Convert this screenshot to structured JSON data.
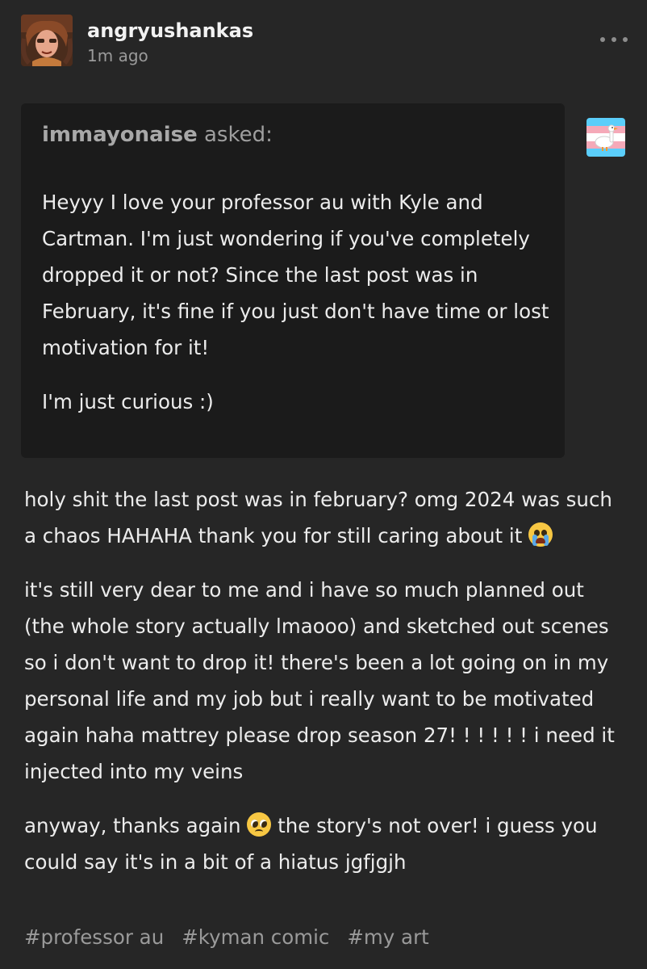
{
  "post": {
    "blog_name": "angryushankas",
    "timestamp": "1m ago",
    "more_icon": "more-horizontal-icon"
  },
  "ask": {
    "asker": "immayonaise",
    "asked_label": " asked:",
    "paragraphs": [
      "Heyyy I love your professor au with Kyle and Cartman. I'm just wondering if you've completely dropped it or not? Since the last post was in February, it's fine if you just don't have time or lost motivation for it!",
      "I'm just curious :)"
    ]
  },
  "answer": {
    "p1": "holy shit the last post was in february? omg 2024 was such a chaos HAHAHA thank you for still caring about it",
    "p2": "it's still very dear to me and i have so much planned out (the whole story actually lmaooo) and sketched out scenes so i don't want to drop it! there's been a lot going on in my personal life and my job but i really want to be motivated again haha mattrey please drop season 27! ! ! ! ! ! i need it injected into my veins",
    "p3_before": "anyway, thanks again",
    "p3_after": " the story's not over! i guess you could say it's in a bit of a hiatus jgfjgjh"
  },
  "tags": [
    "#professor au",
    "#kyman comic",
    "#my art"
  ],
  "colors": {
    "background": "#262626",
    "ask_box": "#1b1b1b",
    "text": "#ececec",
    "muted": "#9a9a9a",
    "trans_blue": "#5bcefa",
    "trans_pink": "#f5a9b8"
  }
}
